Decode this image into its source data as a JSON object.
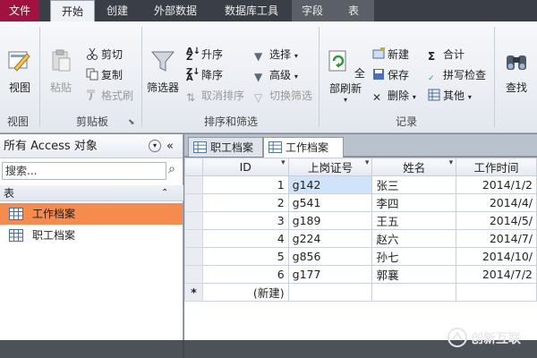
{
  "ribbon_tabs": [
    {
      "label": "文件"
    },
    {
      "label": "开始"
    },
    {
      "label": "创建"
    },
    {
      "label": "外部数据"
    },
    {
      "label": "数据库工具"
    },
    {
      "label": "字段"
    },
    {
      "label": "表"
    }
  ],
  "groups": {
    "views": {
      "label": "视图",
      "btn": "视图"
    },
    "clipboard": {
      "label": "剪贴板",
      "paste": "粘贴",
      "cut": "剪切",
      "copy": "复制",
      "format_painter": "格式刷"
    },
    "sort_filter": {
      "label": "排序和筛选",
      "filter": "筛选器",
      "ascending": "升序",
      "descending": "降序",
      "clear_sort": "取消排序",
      "selection": "选择",
      "advanced": "高级",
      "toggle_filter": "切换筛选"
    },
    "records": {
      "label": "记录",
      "refresh_all": "全部刷新",
      "new": "新建",
      "save": "保存",
      "delete": "删除",
      "totals": "合计",
      "spelling": "拼写检查",
      "more": "其他"
    },
    "find": {
      "find": "查找"
    }
  },
  "nav": {
    "title": "所有 Access 对象",
    "search_placeholder": "搜索...",
    "section": "表",
    "items": [
      {
        "label": "工作档案",
        "selected": true
      },
      {
        "label": "职工档案",
        "selected": false
      }
    ]
  },
  "doc_tabs": [
    {
      "label": "职工档案",
      "active": false
    },
    {
      "label": "工作档案",
      "active": true
    }
  ],
  "datasheet": {
    "columns": [
      "ID",
      "上岗证号",
      "姓名",
      "工作时间"
    ],
    "rows": [
      {
        "id": "1",
        "cert": "g142",
        "name": "张三",
        "date": "2014/1/2"
      },
      {
        "id": "2",
        "cert": "g541",
        "name": "李四",
        "date": "2014/4/"
      },
      {
        "id": "3",
        "cert": "g189",
        "name": "王五",
        "date": "2014/5/"
      },
      {
        "id": "4",
        "cert": "g224",
        "name": "赵六",
        "date": "2014/7/"
      },
      {
        "id": "5",
        "cert": "g856",
        "name": "孙七",
        "date": "2014/10/"
      },
      {
        "id": "6",
        "cert": "g177",
        "name": "郭襄",
        "date": "2014/7/2"
      }
    ],
    "new_row_marker": "*",
    "new_row_label": "(新建)"
  },
  "watermark": "创新互联",
  "colors": {
    "file_tab": "#a1123e",
    "nav_selected": "#f58b4c",
    "selected_cell": "#cfe3fb"
  }
}
